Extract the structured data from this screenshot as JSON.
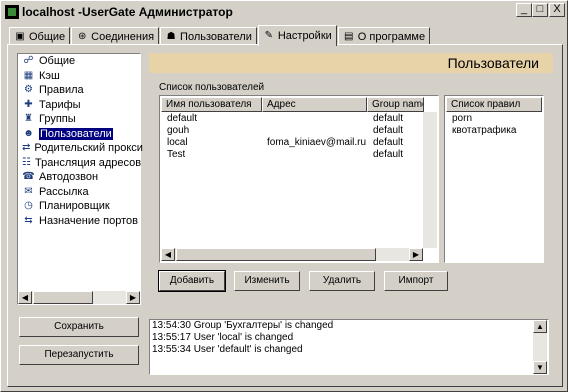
{
  "window": {
    "title": "localhost -UserGate Администратор",
    "btn_min": "_",
    "btn_max": "□",
    "btn_close": "X"
  },
  "tabs": [
    {
      "label": "Общие",
      "icon": "general-icon"
    },
    {
      "label": "Соединения",
      "icon": "connections-icon"
    },
    {
      "label": "Пользователи",
      "icon": "users-icon"
    },
    {
      "label": "Настройки",
      "icon": "settings-icon"
    },
    {
      "label": "О программе",
      "icon": "about-icon"
    }
  ],
  "active_tab": "Настройки",
  "tree": [
    {
      "label": "Общие",
      "icon": "network-icon"
    },
    {
      "label": "Кэш",
      "icon": "cache-icon"
    },
    {
      "label": "Правила",
      "icon": "rules-icon"
    },
    {
      "label": "Тарифы",
      "icon": "tariffs-icon"
    },
    {
      "label": "Группы",
      "icon": "groups-icon"
    },
    {
      "label": "Пользователи",
      "icon": "users-icon"
    },
    {
      "label": "Родительский прокси",
      "icon": "proxy-icon"
    },
    {
      "label": "Трансляция адресов",
      "icon": "nat-icon"
    },
    {
      "label": "Автодозвон",
      "icon": "dialer-icon"
    },
    {
      "label": "Рассылка",
      "icon": "mailing-icon"
    },
    {
      "label": "Планировщик",
      "icon": "scheduler-icon"
    },
    {
      "label": "Назначение портов",
      "icon": "ports-icon"
    }
  ],
  "selected_tree_item": "Пользователи",
  "section_title": "Пользователи",
  "users_caption": "Список пользователей",
  "columns": {
    "name": "Имя пользователя",
    "address": "Адрес",
    "group": "Group name"
  },
  "users": [
    {
      "name": "default",
      "address": "",
      "group": "default"
    },
    {
      "name": "gouh",
      "address": "",
      "group": "default"
    },
    {
      "name": "local",
      "address": "foma_kiniaev@mail.ru",
      "group": "default"
    },
    {
      "name": "Test",
      "address": "",
      "group": "default"
    }
  ],
  "rules_header": "Список правил",
  "rules": [
    "porn",
    "квотатрафика"
  ],
  "buttons": {
    "add": "Добавить",
    "edit": "Изменить",
    "delete": "Удалить",
    "import": "Импорт",
    "save": "Сохранить",
    "restart": "Перезапустить"
  },
  "log": [
    "13:54:30 Group 'Бухгалтеры' is changed",
    "13:55:17 User 'local' is changed",
    "13:55:34 User 'default' is changed"
  ]
}
